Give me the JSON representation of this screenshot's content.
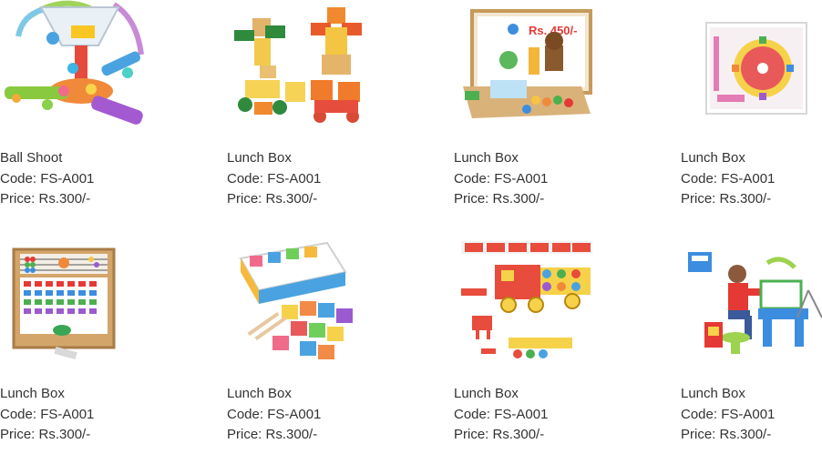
{
  "products": [
    {
      "name": "Ball Shoot",
      "code": "Code: FS-A001",
      "price": "Price: Rs.300/-",
      "image": "ball-shoot-toy-image"
    },
    {
      "name": "Lunch Box",
      "code": "Code: FS-A001",
      "price": "Price: Rs.300/-",
      "image": "wooden-robot-toy-image"
    },
    {
      "name": "Lunch Box",
      "code": "Code: FS-A001",
      "price": "Price: Rs.300/-",
      "image": "magnetic-board-toy-image",
      "image_text": "Rs. 450/-"
    },
    {
      "name": "Lunch Box",
      "code": "Code: FS-A001",
      "price": "Price: Rs.300/-",
      "image": "wooden-clock-toy-image"
    },
    {
      "name": "Lunch Box",
      "code": "Code: FS-A001",
      "price": "Price: Rs.300/-",
      "image": "abacus-alphabet-board-image"
    },
    {
      "name": "Lunch Box",
      "code": "Code: FS-A001",
      "price": "Price: Rs.300/-",
      "image": "animal-blocks-box-image"
    },
    {
      "name": "Lunch Box",
      "code": "Code: FS-A001",
      "price": "Price: Rs.300/-",
      "image": "wooden-truck-toy-image"
    },
    {
      "name": "Lunch Box",
      "code": "Code: FS-A001",
      "price": "Price: Rs.300/-",
      "image": "kids-study-desk-image"
    }
  ],
  "colors": {
    "text": "#333333",
    "background": "#ffffff"
  }
}
